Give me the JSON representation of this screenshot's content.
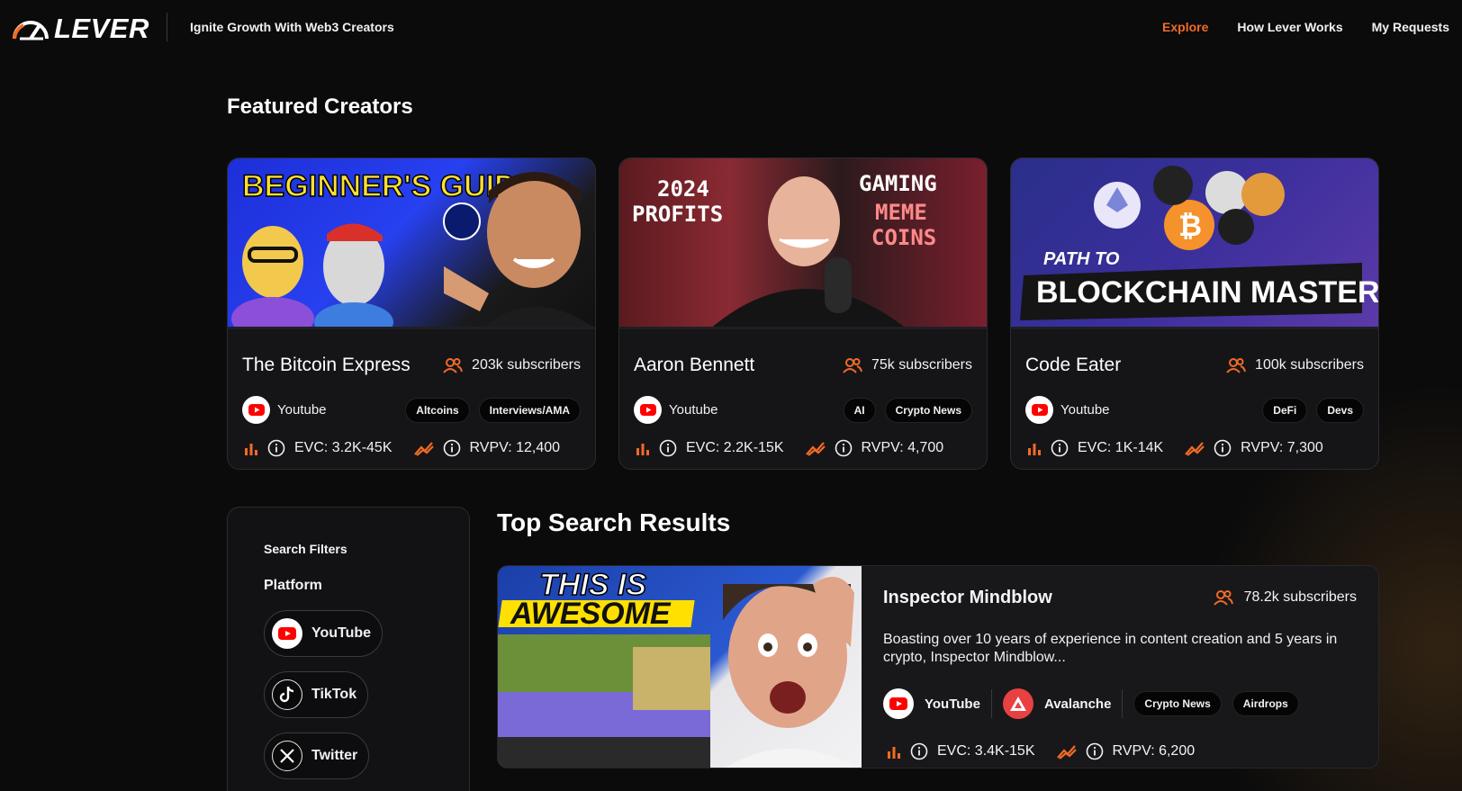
{
  "header": {
    "logo_text": "LEVER",
    "tagline": "Ignite Growth With Web3 Creators",
    "nav": [
      {
        "label": "Explore",
        "active": true
      },
      {
        "label": "How Lever Works",
        "active": false
      },
      {
        "label": "My Requests",
        "active": false
      }
    ]
  },
  "featured": {
    "title": "Featured Creators",
    "cards": [
      {
        "thumb_text": [
          "BEGINNER'S GUIDE"
        ],
        "name": "The Bitcoin Express",
        "subscribers": "203k subscribers",
        "platform": "Youtube",
        "tags": [
          "Altcoins",
          "Interviews/AMA"
        ],
        "evc": "EVC: 3.2K-45K",
        "rvpv": "RVPV: 12,400"
      },
      {
        "thumb_text": [
          "2024",
          "PROFITS",
          "GAMING",
          "MEME",
          "COINS"
        ],
        "name": "Aaron Bennett",
        "subscribers": "75k subscribers",
        "platform": "Youtube",
        "tags": [
          "AI",
          "Crypto News"
        ],
        "evc": "EVC: 2.2K-15K",
        "rvpv": "RVPV: 4,700"
      },
      {
        "thumb_text": [
          "PATH TO",
          "BLOCKCHAIN MASTERY"
        ],
        "name": "Code Eater",
        "subscribers": "100k subscribers",
        "platform": "Youtube",
        "tags": [
          "DeFi",
          "Devs"
        ],
        "evc": "EVC: 1K-14K",
        "rvpv": "RVPV: 7,300"
      }
    ]
  },
  "filters": {
    "title": "Search Filters",
    "platform_heading": "Platform",
    "platforms": [
      "YouTube",
      "TikTok",
      "Twitter"
    ]
  },
  "results": {
    "title": "Top Search Results",
    "items": [
      {
        "thumb_text": [
          "THIS IS",
          "AWESOME"
        ],
        "name": "Inspector Mindblow",
        "subscribers": "78.2k subscribers",
        "description": "Boasting over 10 years of experience in content creation and 5 years in crypto, Inspector Mindblow...",
        "platform": "YouTube",
        "chain": "Avalanche",
        "tags": [
          "Crypto News",
          "Airdrops"
        ],
        "evc": "EVC: 3.4K-15K",
        "rvpv": "RVPV: 6,200"
      }
    ]
  },
  "colors": {
    "accent": "#f26b24",
    "youtube": "#ff0000",
    "avalanche": "#e84142",
    "background": "#0b0b0c",
    "card": "#151518"
  },
  "icons": [
    "speedometer-logo-icon",
    "users-icon",
    "youtube-icon",
    "bar-chart-icon",
    "info-icon",
    "trend-icon",
    "tiktok-icon",
    "x-twitter-icon",
    "avalanche-icon"
  ]
}
